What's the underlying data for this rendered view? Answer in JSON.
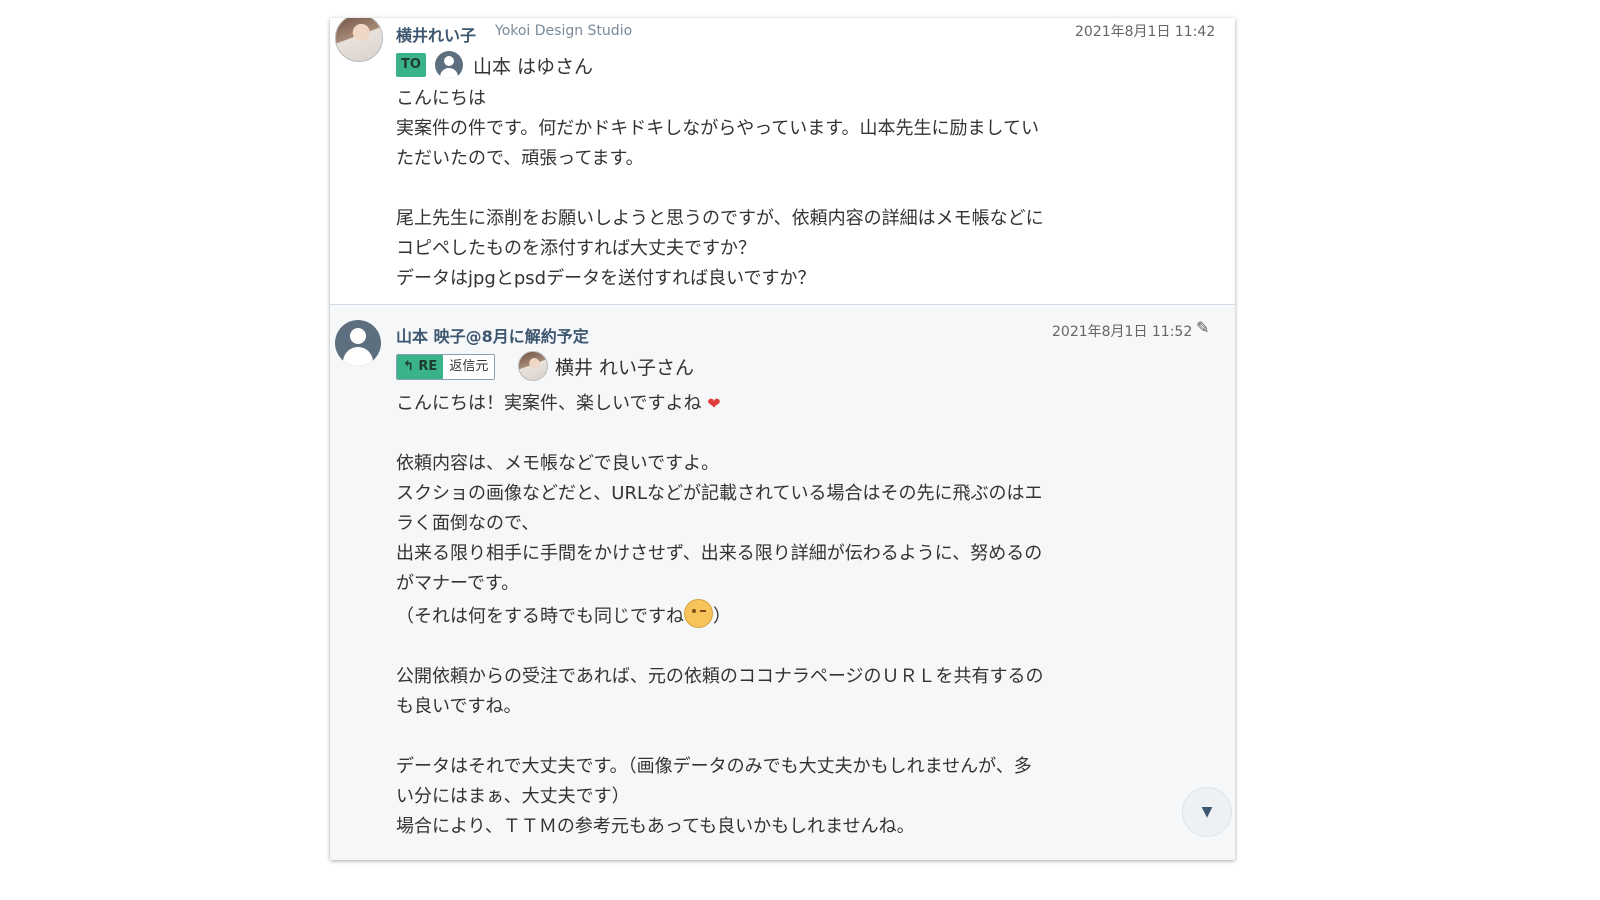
{
  "message1": {
    "sender_name": "横井れい子",
    "sender_org": "Yokoi Design Studio",
    "timestamp": "2021年8月1日 11:42",
    "to_label": "TO",
    "recipient": "山本 はゆさん",
    "lines": [
      "こんにちは",
      "実案件の件です。何だかドキドキしながらやっています。山本先生に励ましてい",
      "ただいたので、頑張ってます。",
      "",
      "尾上先生に添削をお願いしようと思うのですが、依頼内容の詳細はメモ帳などに",
      "コピペしたものを添付すれば大丈夫ですか？",
      "データはjpgとpsdデータを送付すれば良いですか？"
    ]
  },
  "message2": {
    "sender_name": "山本 映子@8月に解約予定",
    "timestamp": "2021年8月1日 11:52",
    "re_label": "RE",
    "source_label": "返信元",
    "recipient": "横井 れい子さん",
    "line_first": "こんにちは！実案件、楽しいですよね",
    "heart_icon": "❤",
    "lines_a": [
      "依頼内容は、メモ帳などで良いですよ。",
      "スクショの画像などだと、URLなどが記載されている場合はその先に飛ぶのはエ",
      "ラく面倒なので、",
      "出来る限り相手に手間をかけさせず、出来る限り詳細が伝わるように、努めるの",
      "がマナーです。"
    ],
    "wink_line_before": "（それは何をする時でも同じですね",
    "wink_line_after": "）",
    "lines_b": [
      "公開依頼からの受注であれば、元の依頼のココナラページのＵＲＬを共有するの",
      "も良いですね。"
    ],
    "lines_c": [
      "データはそれで大丈夫です。（画像データのみでも大丈夫かもしれませんが、多",
      "い分にはまぁ、大丈夫です）",
      "場合により、ＴＴＭの参考元もあっても良いかもしれませんね。"
    ]
  },
  "icons": {
    "edit": "✎",
    "scroll_down": "▼"
  }
}
